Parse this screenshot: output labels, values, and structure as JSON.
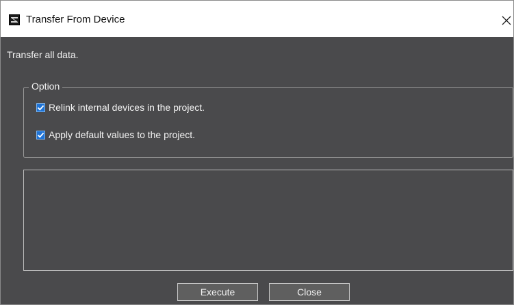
{
  "window": {
    "title": "Transfer From Device",
    "app_icon": "application-icon",
    "close_icon": "close-icon"
  },
  "description": "Transfer all data.",
  "option_group": {
    "label": "Option",
    "checkboxes": [
      {
        "label": "Relink internal devices in the project.",
        "checked": true
      },
      {
        "label": "Apply default values to the project.",
        "checked": true
      }
    ]
  },
  "log_area": {
    "content": ""
  },
  "buttons": {
    "execute_label": "Execute",
    "close_label": "Close"
  },
  "colors": {
    "background": "#4a4a4c",
    "titlebar": "#ffffff",
    "checkbox_accent": "#1e73d6",
    "button_face": "#5f5f5f"
  }
}
